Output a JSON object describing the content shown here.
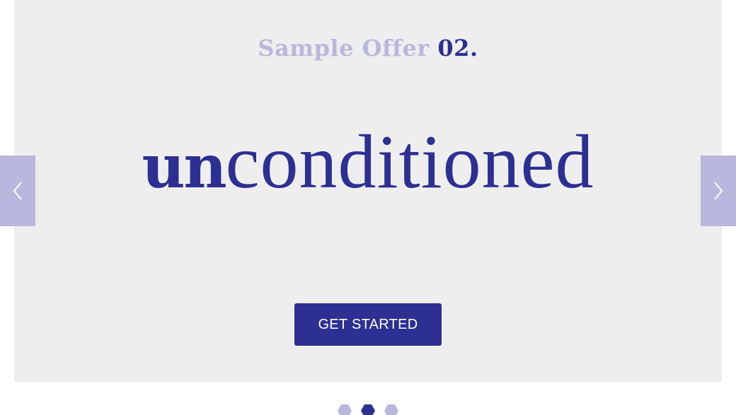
{
  "slide": {
    "offer_lead": "Sample Offer",
    "offer_number": "02.",
    "headline_prefix": "un",
    "headline_stem": "conditioned",
    "cta_label": "GET STARTED"
  },
  "navigation": {
    "prev_icon": "chevron-left-icon",
    "next_icon": "chevron-right-icon"
  },
  "pagination": {
    "total": 3,
    "active": 2
  },
  "colors": {
    "brand": "#2d2f92",
    "light_accent": "#b9b7dd",
    "slide_background": "#eeeeee"
  }
}
